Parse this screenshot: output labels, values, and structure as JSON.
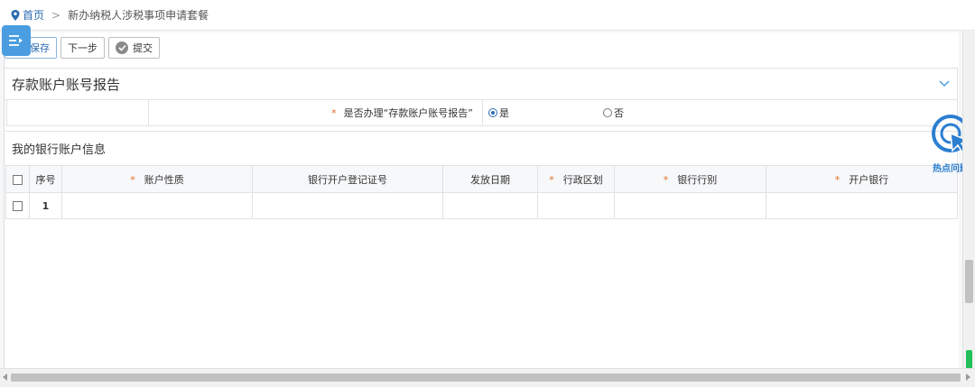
{
  "breadcrumb": {
    "home": "首页",
    "separator": ">",
    "current": "新办纳税人涉税事项申请套餐"
  },
  "toolbar": {
    "save_label": "保存",
    "next_label": "下一步",
    "submit_label": "提交"
  },
  "section": {
    "title": "存款账户账号报告"
  },
  "question": {
    "required_mark": "*",
    "label": "是否办理“存款账户账号报告”",
    "options": [
      {
        "label": "是",
        "selected": true
      },
      {
        "label": "否",
        "selected": false
      }
    ]
  },
  "bank": {
    "title": "我的银行账户信息",
    "headers": [
      {
        "label": "序号",
        "required": false
      },
      {
        "label": "账户性质",
        "required": true
      },
      {
        "label": "银行开户登记证号",
        "required": false
      },
      {
        "label": "发放日期",
        "required": false
      },
      {
        "label": "行政区划",
        "required": true
      },
      {
        "label": "银行行别",
        "required": true
      },
      {
        "label": "开户银行",
        "required": true
      }
    ],
    "rows": [
      {
        "index": "1",
        "cells": [
          "",
          "",
          "",
          "",
          "",
          ""
        ]
      }
    ]
  },
  "hotspot": {
    "label": "热点问题"
  },
  "icons": {
    "menu": "menu-indent-icon",
    "pin": "location-pin-icon",
    "collapse": "chevron-down-icon",
    "hot": "pointer-click-icon"
  },
  "colors": {
    "accent": "#2b6cb0",
    "menu_button": "#4a9de0",
    "required": "#e07020",
    "scroll_indicator": "#22c05a"
  }
}
